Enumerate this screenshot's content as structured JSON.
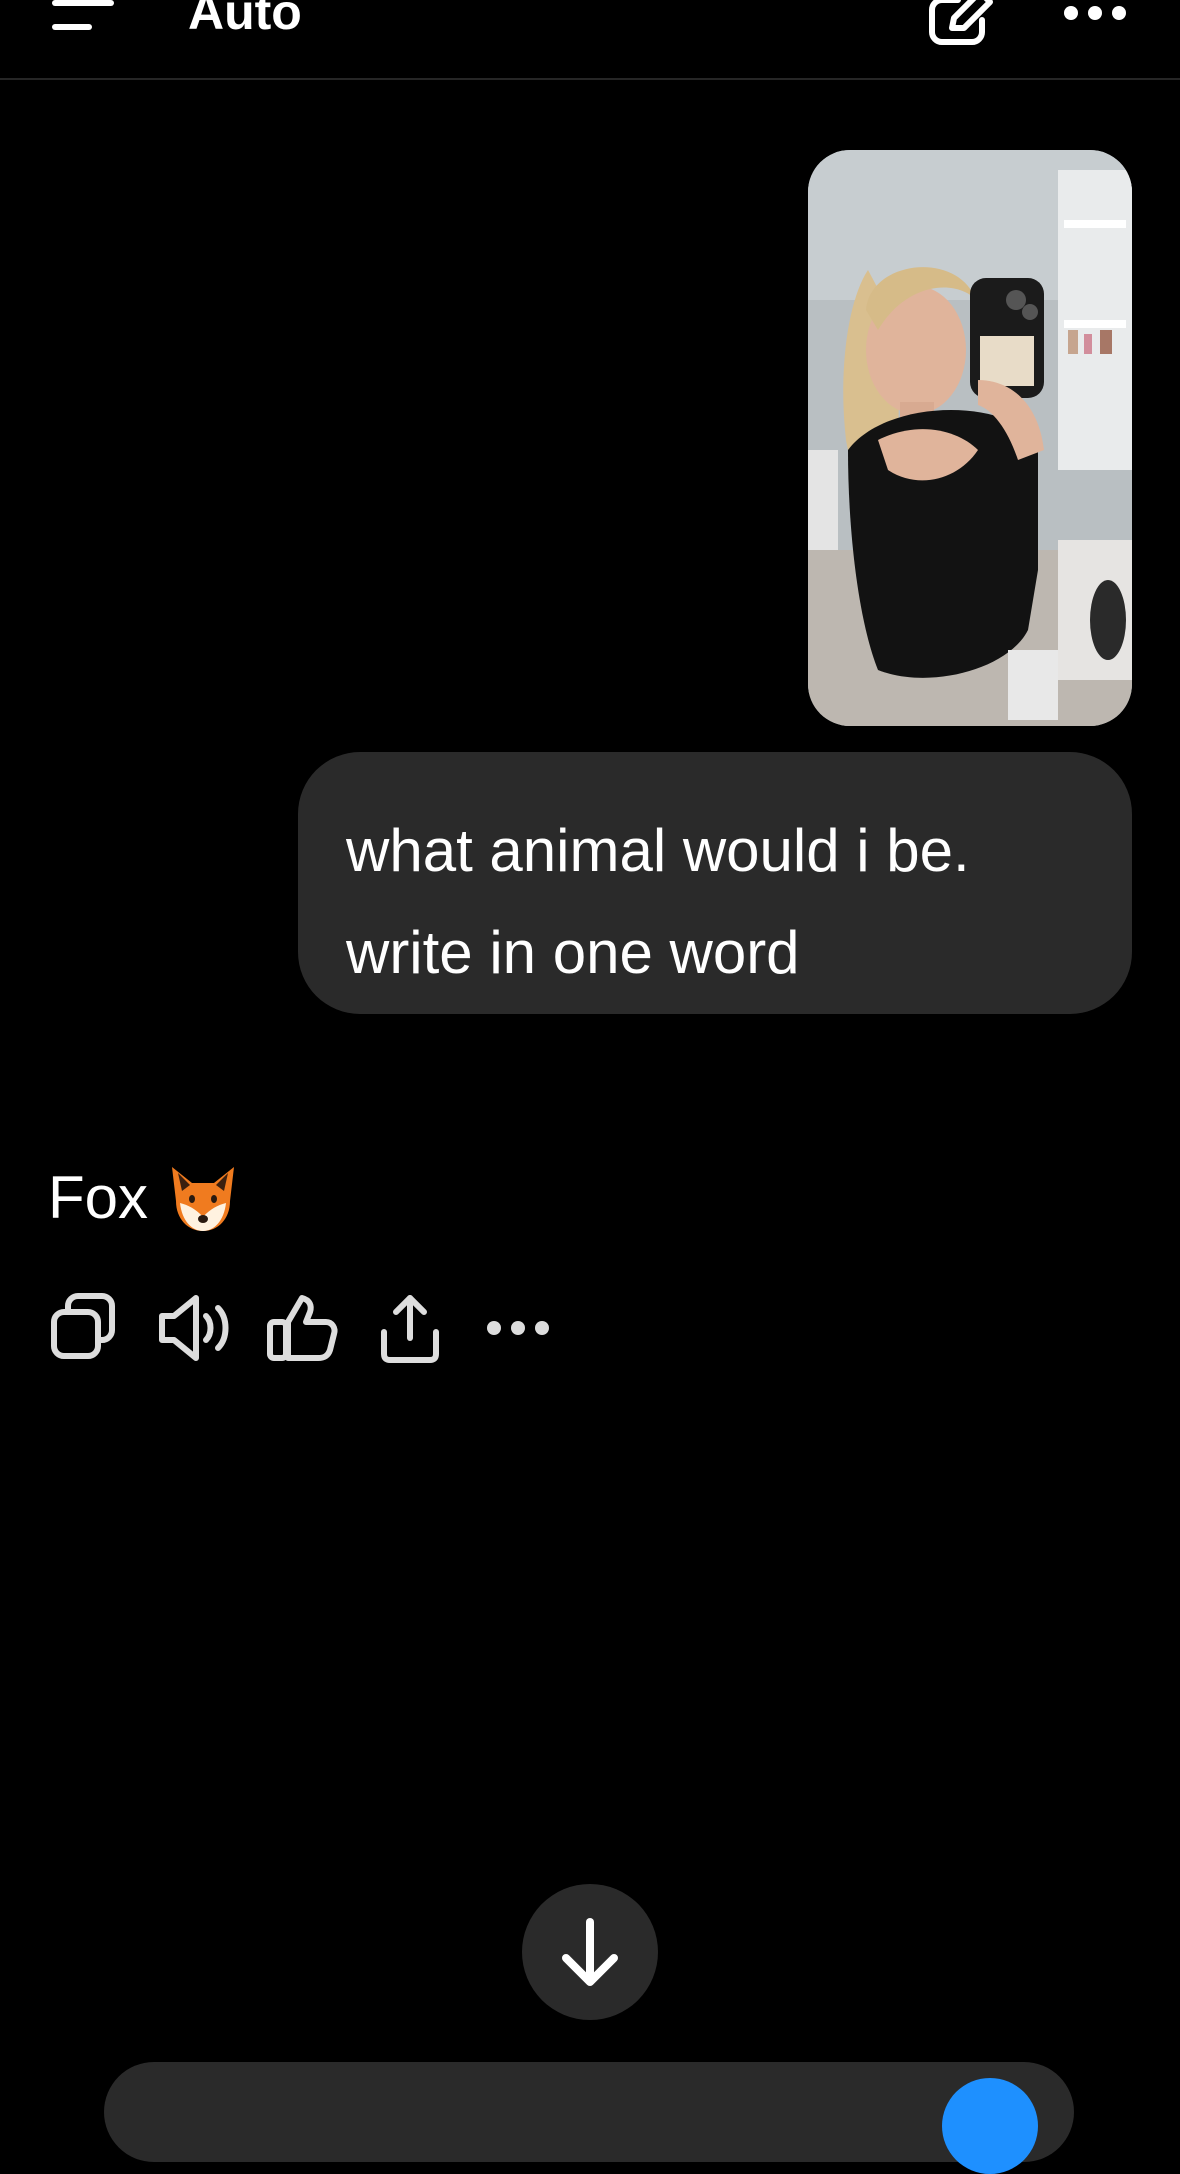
{
  "header": {
    "title": "Auto",
    "icons": [
      "menu-icon",
      "compose-icon",
      "more-icon"
    ]
  },
  "conversation": {
    "user_image_alt": "photo",
    "user_message": "what animal would i be. write in one word",
    "assistant_reply": "Fox",
    "assistant_reply_emoji": "fox-face-icon"
  },
  "actions": [
    "copy-icon",
    "read-aloud-icon",
    "thumbs-down-icon",
    "share-icon",
    "more-icon"
  ],
  "colors": {
    "background": "#000000",
    "bubble": "#2a2a2a",
    "send_accent": "#1e90ff"
  }
}
